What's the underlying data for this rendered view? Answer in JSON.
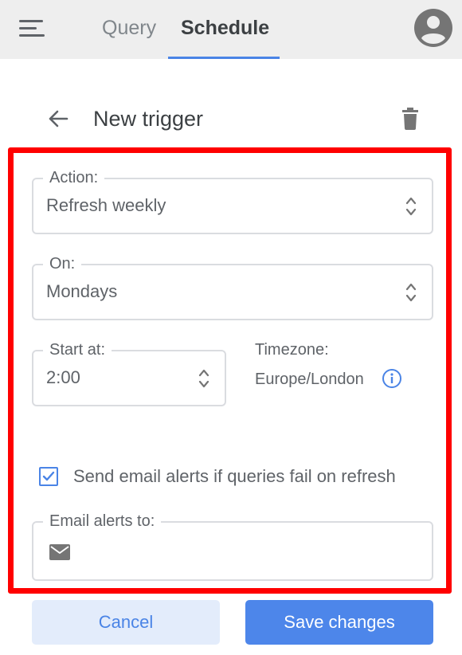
{
  "tabs": [
    {
      "label": "Query",
      "active": false
    },
    {
      "label": "Schedule",
      "active": true
    }
  ],
  "header": {
    "title": "New trigger"
  },
  "form": {
    "action": {
      "label": "Action:",
      "value": "Refresh weekly"
    },
    "on": {
      "label": "On:",
      "value": "Mondays"
    },
    "start_at": {
      "label": "Start at:",
      "value": "2:00"
    },
    "timezone": {
      "label": "Timezone:",
      "value": "Europe/London"
    },
    "email_alerts_checkbox": {
      "label": "Send email alerts if queries fail on refresh",
      "checked": true
    },
    "email_alerts_to": {
      "label": "Email alerts to:",
      "value": ""
    }
  },
  "buttons": {
    "cancel": "Cancel",
    "save": "Save changes"
  },
  "icons": {
    "menu": "menu-icon",
    "avatar": "account-circle-icon",
    "back": "arrow-left-icon",
    "delete": "trash-icon",
    "select": "unfold-arrows-icon",
    "info": "info-icon",
    "check": "check-icon",
    "mail": "mail-icon"
  },
  "colors": {
    "accent": "#4a84e6",
    "highlight_frame": "#ff0000",
    "topbar_bg": "#eeeeee",
    "cancel_bg": "#e3ecfb",
    "save_bg": "#4d86ea"
  }
}
